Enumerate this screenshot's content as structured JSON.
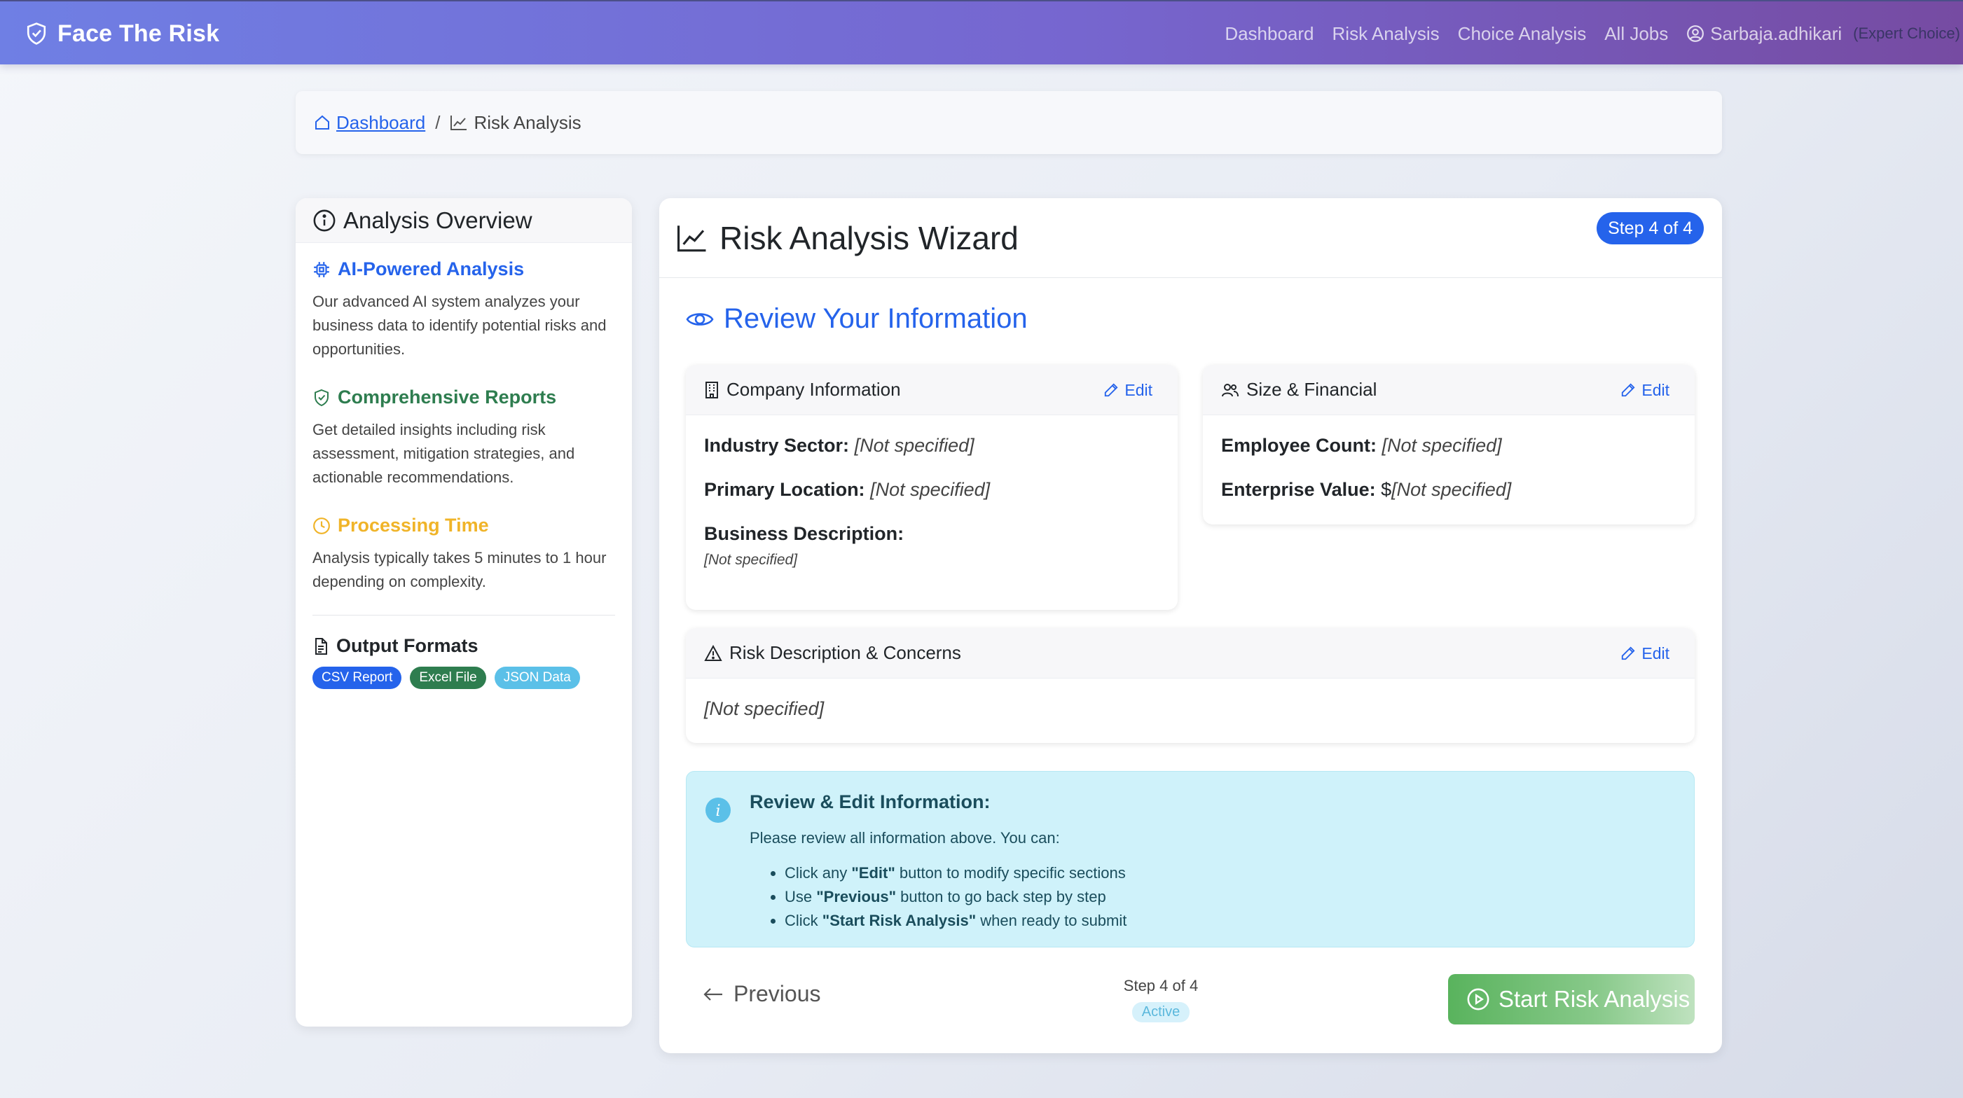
{
  "navbar": {
    "brand": "Face The Risk",
    "links": [
      "Dashboard",
      "Risk Analysis",
      "Choice Analysis",
      "All Jobs"
    ],
    "username": "Sarbaja.adhikari",
    "role": "(Expert Choice)"
  },
  "breadcrumb": {
    "home": "Dashboard",
    "separator": "/",
    "current": "Risk Analysis"
  },
  "sidebar": {
    "title": "Analysis Overview",
    "sections": [
      {
        "title": "AI-Powered Analysis",
        "text": "Our advanced AI system analyzes your business data to identify potential risks and opportunities.",
        "color": "#2563eb"
      },
      {
        "title": "Comprehensive Reports",
        "text": "Get detailed insights including risk assessment, mitigation strategies, and actionable recommendations.",
        "color": "#2e7d4f"
      },
      {
        "title": "Processing Time",
        "text": "Analysis typically takes 5 minutes to 1 hour depending on complexity.",
        "color": "#f0b429"
      }
    ],
    "output_title": "Output Formats",
    "formats": [
      "CSV Report",
      "Excel File",
      "JSON Data"
    ]
  },
  "main": {
    "title": "Risk Analysis Wizard",
    "step_badge": "Step 4 of 4",
    "review_title": "Review Your Information",
    "edit_label": "Edit",
    "company": {
      "title": "Company Information",
      "industry_label": "Industry Sector:",
      "industry_value": "[Not specified]",
      "location_label": "Primary Location:",
      "location_value": "[Not specified]",
      "description_label": "Business Description:",
      "description_value": "[Not specified]"
    },
    "size": {
      "title": "Size & Financial",
      "employee_label": "Employee Count:",
      "employee_value": "[Not specified]",
      "value_label": "Enterprise Value:",
      "value_prefix": "$",
      "value_value": "[Not specified]"
    },
    "risk": {
      "title": "Risk Description & Concerns",
      "value": "[Not specified]"
    },
    "alert": {
      "title": "Review & Edit Information:",
      "intro": "Please review all information above. You can:",
      "items": [
        {
          "pre": "Click any ",
          "bold": "\"Edit\"",
          "post": " button to modify specific sections"
        },
        {
          "pre": "Use ",
          "bold": "\"Previous\"",
          "post": " button to go back step by step"
        },
        {
          "pre": "Click ",
          "bold": "\"Start Risk Analysis\"",
          "post": " when ready to submit"
        }
      ]
    },
    "footer": {
      "previous": "Previous",
      "step_text": "Step 4 of 4",
      "step_status": "Active",
      "start": "Start Risk Analysis"
    }
  },
  "colors": {
    "accent": "#2563eb",
    "success": "#59b35d",
    "info_bg": "#cff2fa",
    "nav_start": "#6f7fe4",
    "nav_end": "#764ba2"
  }
}
